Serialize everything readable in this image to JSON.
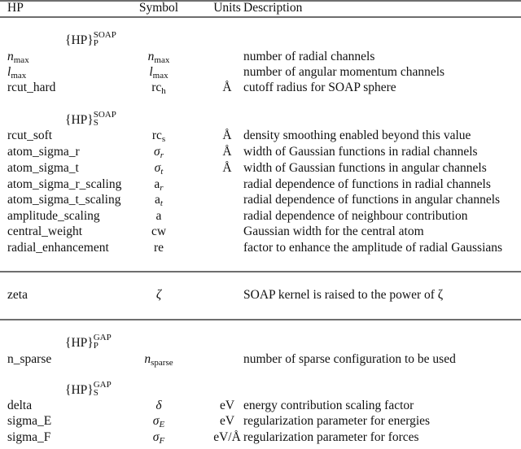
{
  "header": {
    "hp": "HP",
    "symbol": "Symbol",
    "units": "Units",
    "description": "Description"
  },
  "groups": {
    "soap_p": {
      "base": "{HP}",
      "sup": "SOAP",
      "sub": "P"
    },
    "soap_s": {
      "base": "{HP}",
      "sup": "SOAP",
      "sub": "S"
    },
    "gap_p": {
      "base": "{HP}",
      "sup": "GAP",
      "sub": "P"
    },
    "gap_s": {
      "base": "{HP}",
      "sup": "GAP",
      "sub": "S"
    }
  },
  "rows": {
    "n_max": {
      "hp_base": "n",
      "hp_sub": "max",
      "sym_base": "n",
      "sym_sub": "max",
      "units": "",
      "desc": "number of radial channels"
    },
    "l_max": {
      "hp_base": "l",
      "hp_sub": "max",
      "sym_base": "l",
      "sym_sub": "max",
      "units": "",
      "desc": "number of angular momentum channels"
    },
    "rcut_hard": {
      "hp": "rcut_hard",
      "sym_base": "rc",
      "sym_sub": "h",
      "units": "Å",
      "desc": "cutoff radius for SOAP sphere"
    },
    "rcut_soft": {
      "hp": "rcut_soft",
      "sym_base": "rc",
      "sym_sub": "s",
      "units": "Å",
      "desc": "density smoothing enabled beyond this value"
    },
    "atom_sigma_r": {
      "hp": "atom_sigma_r",
      "sym_base": "σ",
      "sym_sub": "r",
      "units": "Å",
      "desc": "width of Gaussian functions in radial channels"
    },
    "atom_sigma_t": {
      "hp": "atom_sigma_t",
      "sym_base": "σ",
      "sym_sub": "t",
      "units": "Å",
      "desc": "width of Gaussian functions in angular channels"
    },
    "atom_sigma_r_scaling": {
      "hp": "atom_sigma_r_scaling",
      "sym_base": "a",
      "sym_sub": "r",
      "units": "",
      "desc": "radial dependence of functions in radial channels"
    },
    "atom_sigma_t_scaling": {
      "hp": "atom_sigma_t_scaling",
      "sym_base": "a",
      "sym_sub": "t",
      "units": "",
      "desc": "radial dependence of functions in angular channels"
    },
    "amplitude_scaling": {
      "hp": "amplitude_scaling",
      "sym": "a",
      "units": "",
      "desc": "radial dependence of neighbour contribution"
    },
    "central_weight": {
      "hp": "central_weight",
      "sym": "cw",
      "units": "",
      "desc": "Gaussian width for the central atom"
    },
    "radial_enhancement": {
      "hp": "radial_enhancement",
      "sym": "re",
      "units": "",
      "desc": "factor to enhance the amplitude of radial Gaussians"
    },
    "zeta": {
      "hp": "zeta",
      "sym": "ζ",
      "units": "",
      "desc": "SOAP kernel is raised to the power of ζ"
    },
    "n_sparse": {
      "hp": "n_sparse",
      "sym_base": "n",
      "sym_sub": "sparse",
      "units": "",
      "desc": "number of sparse configuration to be used"
    },
    "delta": {
      "hp": "delta",
      "sym": "δ",
      "units": "eV",
      "desc": "energy contribution scaling factor"
    },
    "sigma_E": {
      "hp": "sigma_E",
      "sym_base": "σ",
      "sym_sub": "E",
      "units": "eV",
      "desc": "regularization parameter for energies"
    },
    "sigma_F": {
      "hp": "sigma_F",
      "sym_base": "σ",
      "sym_sub": "F",
      "units": "eV/Å",
      "desc": "regularization parameter for forces"
    }
  }
}
